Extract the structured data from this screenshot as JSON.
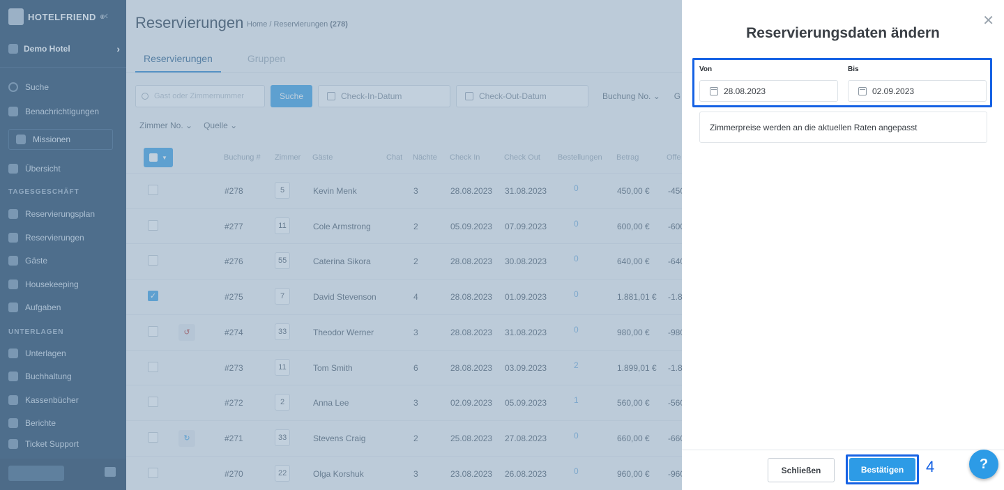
{
  "sidebar": {
    "brand": "HOTELFRIEND",
    "brand_mark": "®",
    "hotel": "Demo Hotel",
    "items_top": [
      {
        "label": "Suche",
        "icon": "search-icon"
      },
      {
        "label": "Benachrichtigungen",
        "icon": "bell-icon"
      }
    ],
    "missions": "Missionen",
    "overview": "Übersicht",
    "section1": "TAGESGESCHÄFT",
    "section1_items": [
      "Reservierungsplan",
      "Reservierungen",
      "Gäste",
      "Housekeeping",
      "Aufgaben"
    ],
    "section2": "UNTERLAGEN",
    "section2_items": [
      "Unterlagen",
      "Buchhaltung",
      "Kassenbücher",
      "Berichte",
      "Ticket Support"
    ]
  },
  "main": {
    "title": "Reservierungen",
    "breadcrumb_home": "Home",
    "breadcrumb_sep": "/",
    "breadcrumb_page": "Reservierungen",
    "breadcrumb_count": "(278)",
    "tabs": [
      "Reservierungen",
      "Gruppen"
    ],
    "search_placeholder": "Gast oder Zimmernummer",
    "search_button": "Suche",
    "checkin_filter": "Check-In-Datum",
    "checkout_filter": "Check-Out-Datum",
    "booking_filter": "Buchung No.",
    "extra_filter": "G",
    "room_filter": "Zimmer No.",
    "source_filter": "Quelle",
    "columns": [
      "Buchung #",
      "Zimmer",
      "Gäste",
      "Chat",
      "Nächte",
      "Check In",
      "Check Out",
      "Bestellungen",
      "Betrag",
      "Offe"
    ],
    "rows": [
      {
        "booking": "#278",
        "room": "5",
        "guest": "Kevin Menk",
        "nights": "3",
        "checkin": "28.08.2023",
        "checkout": "31.08.2023",
        "orders": "0",
        "amount": "450,00 €",
        "open": "-450",
        "checked": false,
        "hist": ""
      },
      {
        "booking": "#277",
        "room": "11",
        "guest": "Cole Armstrong",
        "nights": "2",
        "checkin": "05.09.2023",
        "checkout": "07.09.2023",
        "orders": "0",
        "amount": "600,00 €",
        "open": "-600",
        "checked": false,
        "hist": ""
      },
      {
        "booking": "#276",
        "room": "55",
        "guest": "Caterina Sikora",
        "nights": "2",
        "checkin": "28.08.2023",
        "checkout": "30.08.2023",
        "orders": "0",
        "amount": "640,00 €",
        "open": "-640",
        "checked": false,
        "hist": ""
      },
      {
        "booking": "#275",
        "room": "7",
        "guest": "David Stevenson",
        "nights": "4",
        "checkin": "28.08.2023",
        "checkout": "01.09.2023",
        "orders": "0",
        "amount": "1.881,01 €",
        "open": "-1.8",
        "checked": true,
        "hist": ""
      },
      {
        "booking": "#274",
        "room": "33",
        "guest": "Theodor Werner",
        "nights": "3",
        "checkin": "28.08.2023",
        "checkout": "31.08.2023",
        "orders": "0",
        "amount": "980,00 €",
        "open": "-980",
        "checked": false,
        "hist": "↺"
      },
      {
        "booking": "#273",
        "room": "11",
        "guest": "Tom Smith",
        "nights": "6",
        "checkin": "28.08.2023",
        "checkout": "03.09.2023",
        "orders": "2",
        "amount": "1.899,01 €",
        "open": "-1.8",
        "checked": false,
        "hist": ""
      },
      {
        "booking": "#272",
        "room": "2",
        "guest": "Anna Lee",
        "nights": "3",
        "checkin": "02.09.2023",
        "checkout": "05.09.2023",
        "orders": "1",
        "amount": "560,00 €",
        "open": "-560",
        "checked": false,
        "hist": ""
      },
      {
        "booking": "#271",
        "room": "33",
        "guest": "Stevens Craig",
        "nights": "2",
        "checkin": "25.08.2023",
        "checkout": "27.08.2023",
        "orders": "0",
        "amount": "660,00 €",
        "open": "-660",
        "checked": false,
        "hist": "↻"
      },
      {
        "booking": "#270",
        "room": "22",
        "guest": "Olga Korshuk",
        "nights": "3",
        "checkin": "23.08.2023",
        "checkout": "26.08.2023",
        "orders": "0",
        "amount": "960,00 €",
        "open": "-960",
        "checked": false,
        "hist": ""
      }
    ]
  },
  "modal": {
    "title": "Reservierungsdaten ändern",
    "from_label": "Von",
    "to_label": "Bis",
    "from_value": "28.08.2023",
    "to_value": "02.09.2023",
    "info": "Zimmerpreise werden an die aktuellen Raten angepasst",
    "close_button": "Schließen",
    "confirm_button": "Bestätigen",
    "step_marker": "4",
    "help": "?"
  },
  "colors": {
    "sidebar_bg": "#2d4e6c",
    "accent": "#2d9be6",
    "highlight": "#1662e4"
  }
}
